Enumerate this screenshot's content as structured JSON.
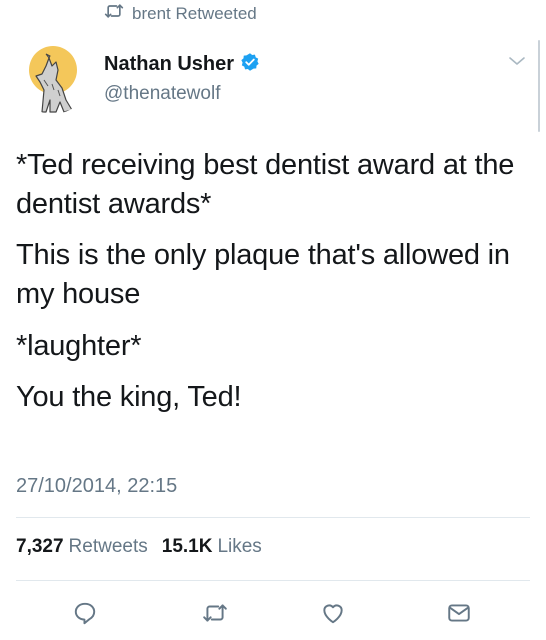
{
  "retweet_context": {
    "text": "brent Retweeted",
    "icon": "retweet-icon"
  },
  "author": {
    "name": "Nathan Usher",
    "handle": "@thenatewolf",
    "verified": true,
    "avatar_icon": "howling-wolf-avatar"
  },
  "tweet": {
    "paragraphs": [
      "*Ted receiving best dentist award at the dentist awards*",
      "This is the only plaque that's allowed in my house",
      "*laughter*",
      "You the king, Ted!"
    ],
    "timestamp": "27/10/2014, 22:15"
  },
  "stats": {
    "retweets_count": "7,327",
    "retweets_label": "Retweets",
    "likes_count": "15.1K",
    "likes_label": "Likes"
  },
  "actions": [
    {
      "name": "reply",
      "icon": "reply-icon"
    },
    {
      "name": "retweet",
      "icon": "retweet-icon"
    },
    {
      "name": "like",
      "icon": "heart-icon"
    },
    {
      "name": "direct-message",
      "icon": "envelope-icon"
    }
  ],
  "colors": {
    "text_primary": "#14171a",
    "text_secondary": "#657786",
    "verified_blue": "#1da1f2",
    "avatar_sun": "#f4c75a",
    "divider": "#e1e8ed"
  }
}
